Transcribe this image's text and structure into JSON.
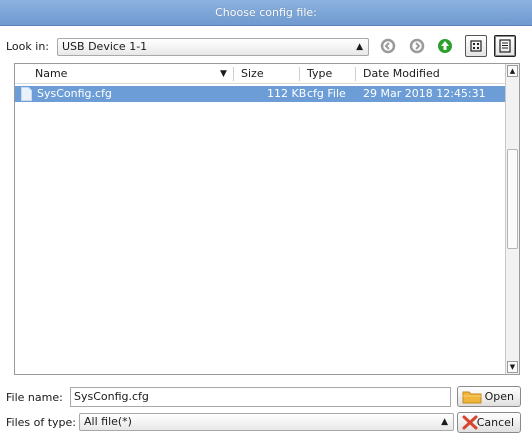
{
  "window": {
    "title": "Choose config file:"
  },
  "lookin": {
    "label": "Look in:",
    "value": "USB Device 1-1"
  },
  "toolbar": {
    "icons": [
      "back-icon",
      "forward-icon",
      "parent-directory-icon",
      "list-view-icon",
      "detail-view-icon"
    ]
  },
  "filelist": {
    "columns": [
      "Name",
      "Size",
      "Type",
      "Date Modified"
    ],
    "rows": [
      {
        "name": "SysConfig.cfg",
        "size": "112 KB",
        "type": "cfg File",
        "modified": "29 Mar 2018 12:45:31"
      }
    ]
  },
  "filename": {
    "label": "File name:",
    "value": "SysConfig.cfg"
  },
  "filetype": {
    "label": "Files of type:",
    "value": "All file(*)"
  },
  "buttons": {
    "open": "Open",
    "cancel": "Cancel"
  },
  "colors": {
    "titlebar": "#7aa3d6",
    "selection": "#6c9dd6",
    "up_arrow": "#2ca02c",
    "cancel_x": "#d9442e"
  }
}
